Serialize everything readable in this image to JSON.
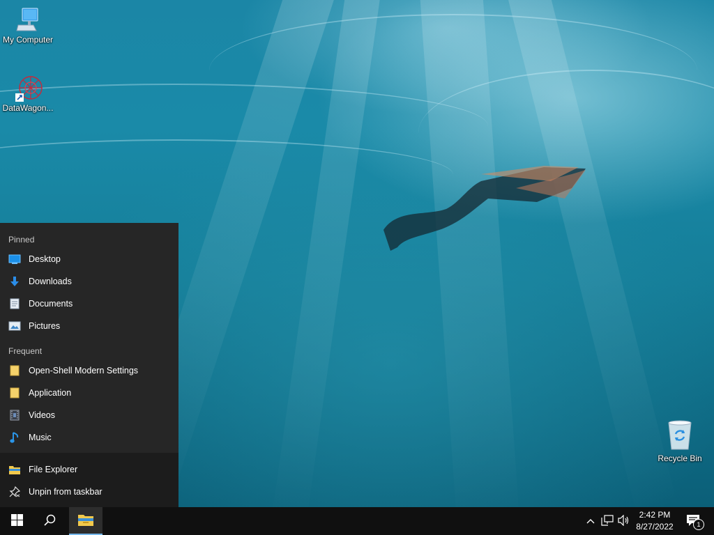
{
  "desktop": {
    "icons": [
      {
        "label": "My Computer",
        "icon": "computer-icon"
      },
      {
        "label": "DataWagon...",
        "icon": "datawagon-shortcut-icon"
      },
      {
        "label": "Recycle Bin",
        "icon": "recycle-bin-icon"
      }
    ]
  },
  "jumplist": {
    "pinned_header": "Pinned",
    "pinned": [
      {
        "label": "Desktop",
        "icon": "desktop-folder-icon"
      },
      {
        "label": "Downloads",
        "icon": "download-arrow-icon"
      },
      {
        "label": "Documents",
        "icon": "document-icon"
      },
      {
        "label": "Pictures",
        "icon": "pictures-icon"
      }
    ],
    "frequent_header": "Frequent",
    "frequent": [
      {
        "label": "Open-Shell Modern Settings",
        "icon": "folder-icon"
      },
      {
        "label": "Application",
        "icon": "folder-icon"
      },
      {
        "label": "Videos",
        "icon": "video-icon"
      },
      {
        "label": "Music",
        "icon": "music-note-icon"
      }
    ],
    "actions": [
      {
        "label": "File Explorer",
        "icon": "file-explorer-icon"
      },
      {
        "label": "Unpin from taskbar",
        "icon": "unpin-icon"
      }
    ]
  },
  "taskbar": {
    "start": "windows-start-icon",
    "search": "search-icon",
    "pinned_app": "file-explorer-icon",
    "tray": {
      "chevron": "chevron-up-icon",
      "network": "network-icon",
      "volume": "volume-icon",
      "time": "2:42 PM",
      "date": "8/27/2022",
      "notification_count": "1"
    }
  },
  "colors": {
    "accent": "#76b9ed",
    "jumplist_bg": "#262626",
    "taskbar_bg": "#101010"
  }
}
